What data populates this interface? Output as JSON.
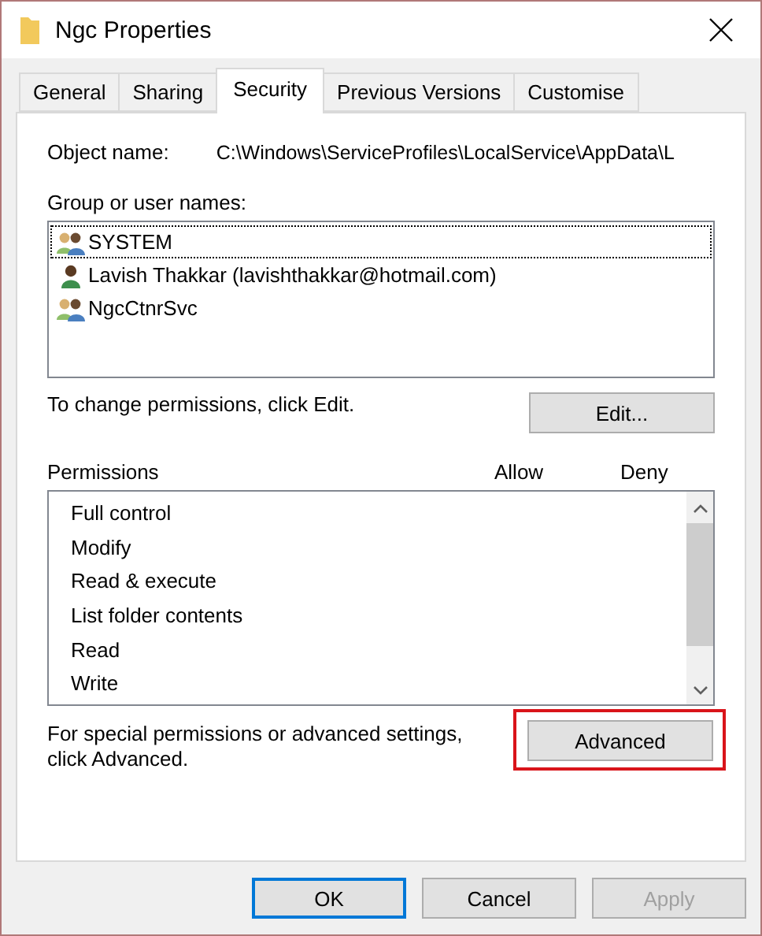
{
  "window": {
    "title": "Ngc Properties"
  },
  "tabs": [
    {
      "label": "General",
      "selected": false
    },
    {
      "label": "Sharing",
      "selected": false
    },
    {
      "label": "Security",
      "selected": true
    },
    {
      "label": "Previous Versions",
      "selected": false
    },
    {
      "label": "Customise",
      "selected": false
    }
  ],
  "object_name": {
    "label": "Object name:",
    "value": "C:\\Windows\\ServiceProfiles\\LocalService\\AppData\\L"
  },
  "users": {
    "label": "Group or user names:",
    "items": [
      {
        "kind": "group",
        "name": "SYSTEM",
        "selected": true
      },
      {
        "kind": "user",
        "name": "Lavish Thakkar (lavishthakkar@hotmail.com)",
        "selected": false
      },
      {
        "kind": "group",
        "name": "NgcCtnrSvc",
        "selected": false
      }
    ]
  },
  "edit_hint": "To change permissions, click Edit.",
  "edit_button": "Edit...",
  "permissions": {
    "label": "Permissions",
    "columns": [
      "Allow",
      "Deny"
    ],
    "items": [
      "Full control",
      "Modify",
      "Read & execute",
      "List folder contents",
      "Read",
      "Write"
    ]
  },
  "advanced_hint": "For special permissions or advanced settings, click Advanced.",
  "advanced_button": {
    "label": "Advanced",
    "highlighted": true
  },
  "buttons": [
    {
      "label": "OK",
      "default": true,
      "disabled": false
    },
    {
      "label": "Cancel",
      "default": false,
      "disabled": false
    },
    {
      "label": "Apply",
      "default": false,
      "disabled": true
    }
  ]
}
